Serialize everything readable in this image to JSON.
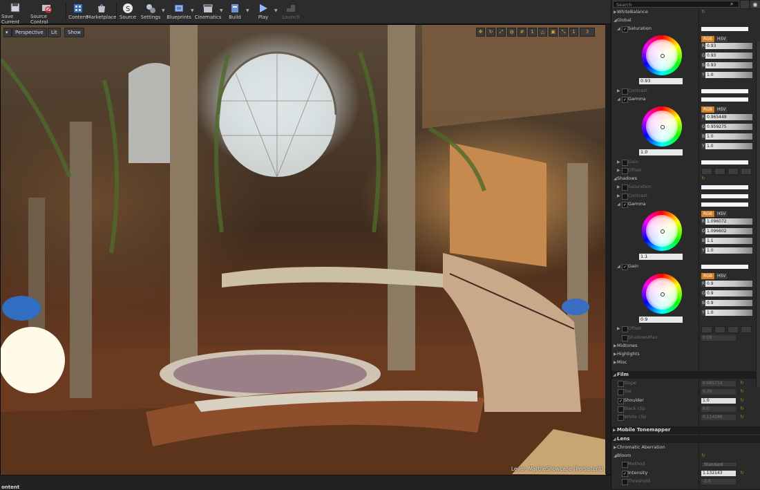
{
  "toolbar": {
    "buttons": [
      {
        "label": "Save Current",
        "icon": "save-icon"
      },
      {
        "label": "Source Control",
        "icon": "source-control-icon"
      },
      {
        "label": "Content",
        "icon": "content-icon"
      },
      {
        "label": "Marketplace",
        "icon": "marketplace-icon"
      },
      {
        "label": "Source",
        "icon": "source-icon"
      },
      {
        "label": "Settings",
        "icon": "settings-icon"
      },
      {
        "label": "Blueprints",
        "icon": "blueprints-icon"
      },
      {
        "label": "Cinematics",
        "icon": "cinematics-icon"
      },
      {
        "label": "Build",
        "icon": "build-icon"
      },
      {
        "label": "Play",
        "icon": "play-icon"
      },
      {
        "label": "Launch",
        "icon": "launch-icon"
      }
    ]
  },
  "viewport": {
    "perspective": "Perspective",
    "lit": "Lit",
    "show": "Show",
    "level_label": "Level: MarbleShowcase (Persistent)",
    "camera_speed": "1",
    "layer_count": "3"
  },
  "bottom": {
    "label": "ontent"
  },
  "details": {
    "search_placeholder": "Search",
    "white_balance": "WhiteBalance",
    "global": "Global",
    "saturation": "Saturation",
    "saturation_wheel": "0.93",
    "sat_r": "0.93",
    "sat_g": "0.93",
    "sat_b": "0.93",
    "sat_y": "1.0",
    "contrast": "Contrast",
    "gamma": "Gamma",
    "gamma_wheel": "1.0",
    "gam_r": "0.965449",
    "gam_g": "0.959275",
    "gam_b": "1.0",
    "gam_y": "1.0",
    "gain": "Gain",
    "offset": "Offset",
    "shadows": "Shadows",
    "sh_saturation": "Saturation",
    "sh_contrast": "Contrast",
    "sh_gamma": "Gamma",
    "sh_gamma_wheel": "1.1",
    "shg_r": "1.096072",
    "shg_g": "1.096602",
    "shg_b": "1.1",
    "shg_y": "1.0",
    "sh_gain": "Gain",
    "sh_gain_wheel": "0.9",
    "shgn_r": "0.9",
    "shgn_g": "0.9",
    "shgn_b": "0.9",
    "shgn_y": "1.0",
    "sh_offset": "Offset",
    "shadows_max": "ShadowsMax",
    "shadows_max_val": "0.09",
    "midtones": "Midtones",
    "highlights": "Highlights",
    "misc": "Misc",
    "film": "Film",
    "slope": "Slope",
    "slope_val": "0.685714",
    "toe": "Toe",
    "toe_val": "0.35",
    "shoulder": "Shoulder",
    "shoulder_val": "1.0",
    "black_clip": "Black clip",
    "black_clip_val": "0.0",
    "white_clip": "White clip",
    "white_clip_val": "0.114286",
    "mobile_tonemapper": "Mobile Tonemapper",
    "lens": "Lens",
    "chromatic_aberration": "Chromatic Aberration",
    "bloom": "Bloom",
    "method": "Method",
    "method_val": "Standard",
    "intensity": "Intensity",
    "intensity_val": "1.132143",
    "threshold": "Threshold",
    "threshold_val": "-1.0",
    "rgb": "RGB",
    "hsv": "HSV",
    "ch_r": "R",
    "ch_g": "G",
    "ch_b": "B",
    "ch_y": "Y"
  }
}
